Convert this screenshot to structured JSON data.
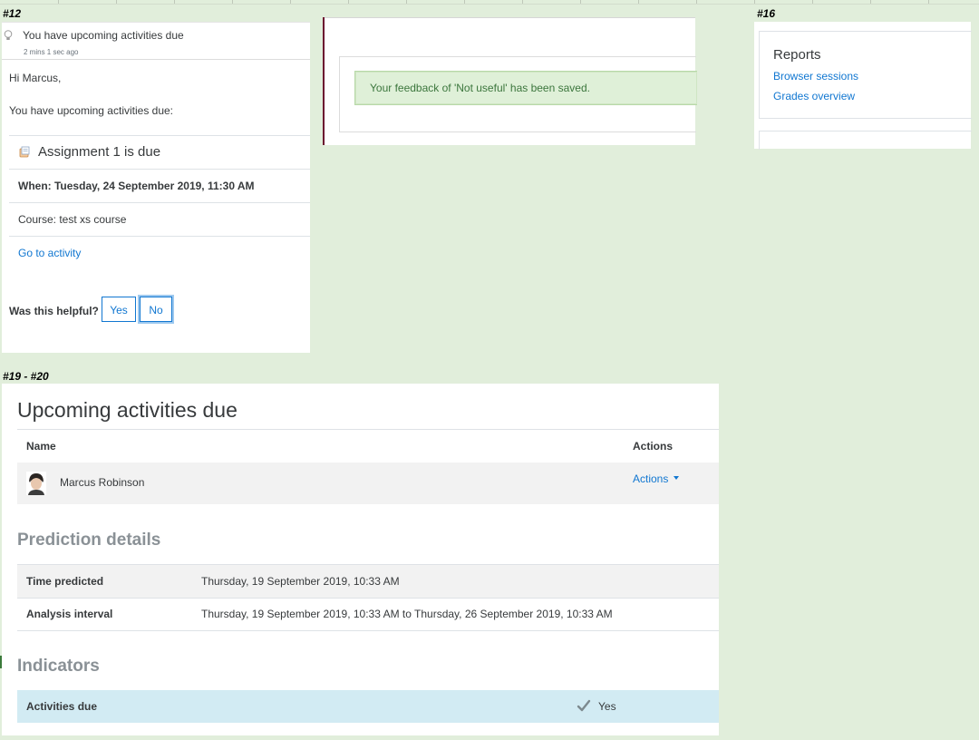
{
  "labels": {
    "s12": "#12",
    "s16": "#16",
    "s19": "#19 - #20"
  },
  "notification": {
    "title": "You have upcoming activities due",
    "time": "2 mins 1 sec ago",
    "greeting": "Hi Marcus,",
    "intro": "You have upcoming activities due:",
    "activity_title": "Assignment 1 is due",
    "when": "When: Tuesday, 24 September 2019, 11:30 AM",
    "course": "Course: test xs course",
    "link": "Go to activity",
    "helpful_question": "Was this helpful?",
    "yes": "Yes",
    "no": "No"
  },
  "feedback": {
    "message": "Your feedback of 'Not useful' has been saved."
  },
  "reports": {
    "title": "Reports",
    "links": [
      "Browser sessions",
      "Grades overview"
    ]
  },
  "prediction": {
    "title": "Upcoming activities due",
    "col_name": "Name",
    "col_actions": "Actions",
    "user": "Marcus Robinson",
    "actions": "Actions",
    "details_heading": "Prediction details",
    "details": [
      {
        "label": "Time predicted",
        "value": "Thursday, 19 September 2019, 10:33 AM"
      },
      {
        "label": "Analysis interval",
        "value": "Thursday, 19 September 2019, 10:33 AM to Thursday, 26 September 2019, 10:33 AM"
      }
    ],
    "indicators_heading": "Indicators",
    "indicators": [
      {
        "label": "Activities due",
        "value": "Yes"
      }
    ]
  },
  "colors": {
    "background": "#e1eedb",
    "link": "#1177d1",
    "success_text": "#3c763d",
    "success_bg": "#dff0d8",
    "indicator_bg": "#d2ebf3",
    "muted_heading": "#8a9196"
  },
  "icons": [
    "lightbulb-icon",
    "assignment-icon",
    "caret-down-icon",
    "checkmark-icon",
    "user-avatar"
  ]
}
